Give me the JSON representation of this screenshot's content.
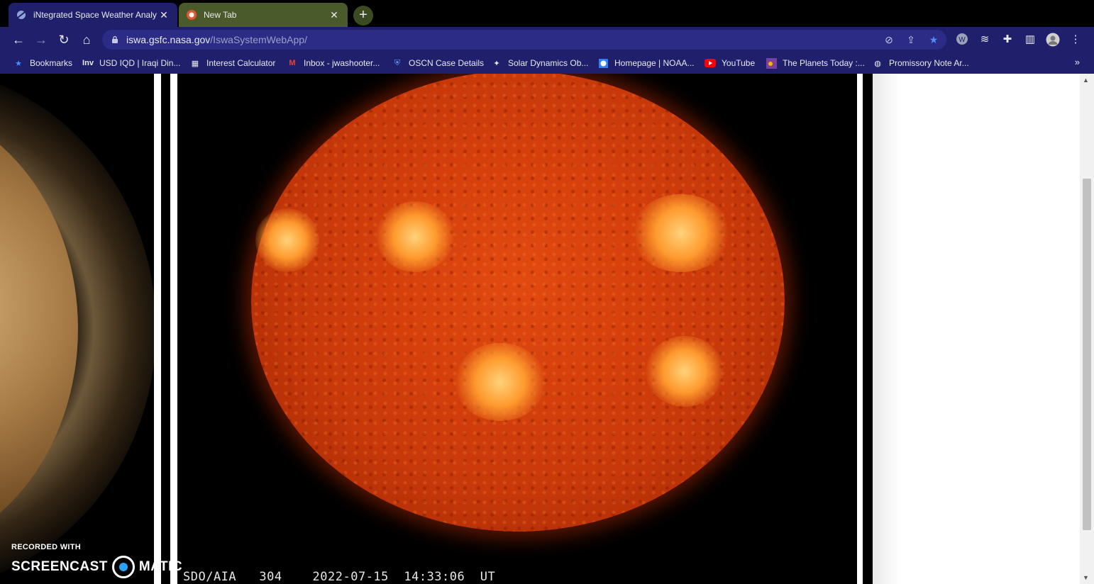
{
  "tabs": [
    {
      "title": "iNtegrated Space Weather Analy",
      "icon": "satellite-icon",
      "active": true
    },
    {
      "title": "New Tab",
      "icon": "duckduckgo-icon",
      "active": false
    }
  ],
  "toolbar": {
    "url_host": "iswa.gsfc.nasa.gov",
    "url_path": "/IswaSystemWebApp/"
  },
  "bookmarks": [
    {
      "label": "Bookmarks",
      "icon": "star-icon"
    },
    {
      "label": "USD IQD | Iraqi Din...",
      "icon": "investing-icon"
    },
    {
      "label": "Interest Calculator",
      "icon": "calculator-icon"
    },
    {
      "label": "Inbox - jwashooter...",
      "icon": "gmail-icon"
    },
    {
      "label": "OSCN Case Details",
      "icon": "shield-icon"
    },
    {
      "label": "Solar Dynamics Ob...",
      "icon": "satellite-icon"
    },
    {
      "label": "Homepage | NOAA...",
      "icon": "noaa-icon"
    },
    {
      "label": "YouTube",
      "icon": "youtube-icon"
    },
    {
      "label": "The Planets Today :...",
      "icon": "planets-icon"
    },
    {
      "label": "Promissory Note Ar...",
      "icon": "globe-icon"
    }
  ],
  "bookmarks_overflow": "»",
  "image": {
    "instrument": "SDO/AIA",
    "wavelength": "304",
    "timestamp": "2022-07-15  14:33:06  UT"
  },
  "watermark": {
    "line1": "RECORDED WITH",
    "brand_left": "SCREENCAST",
    "brand_right": "MATIC"
  },
  "colors": {
    "toolbar": "#1f1f6b",
    "inactive_tab": "#4a5a2a",
    "sun": "#d43f0c"
  }
}
